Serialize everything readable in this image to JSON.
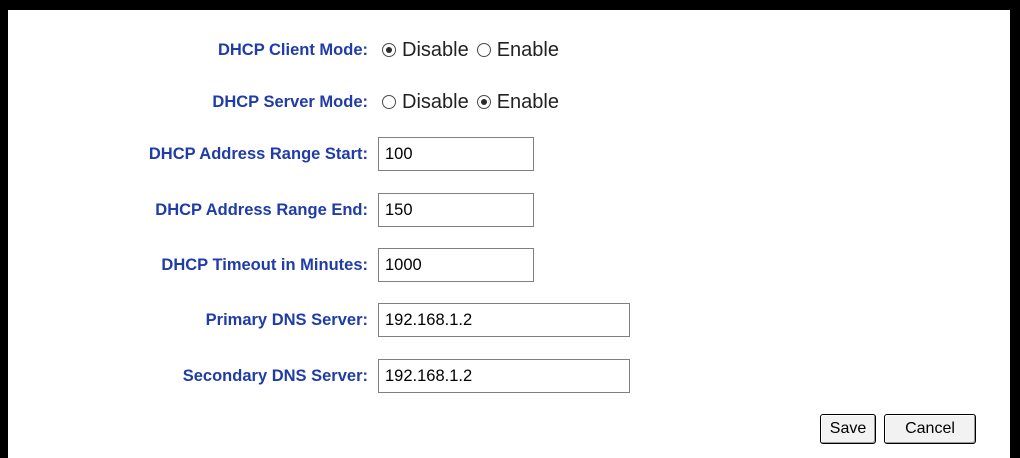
{
  "form": {
    "dhcp_client_mode": {
      "label": "DHCP Client Mode:",
      "options": [
        "Disable",
        "Enable"
      ],
      "selected": "Disable"
    },
    "dhcp_server_mode": {
      "label": "DHCP Server Mode:",
      "options": [
        "Disable",
        "Enable"
      ],
      "selected": "Enable"
    },
    "range_start": {
      "label": "DHCP Address Range Start:",
      "value": "100"
    },
    "range_end": {
      "label": "DHCP Address Range End:",
      "value": "150"
    },
    "timeout": {
      "label": "DHCP Timeout in Minutes:",
      "value": "1000"
    },
    "primary_dns": {
      "label": "Primary DNS Server:",
      "value": "192.168.1.2"
    },
    "secondary_dns": {
      "label": "Secondary DNS Server:",
      "value": "192.168.1.2"
    }
  },
  "buttons": {
    "save": "Save",
    "cancel": "Cancel"
  },
  "colors": {
    "label": "#1f3ca8",
    "frame": "#000000"
  }
}
